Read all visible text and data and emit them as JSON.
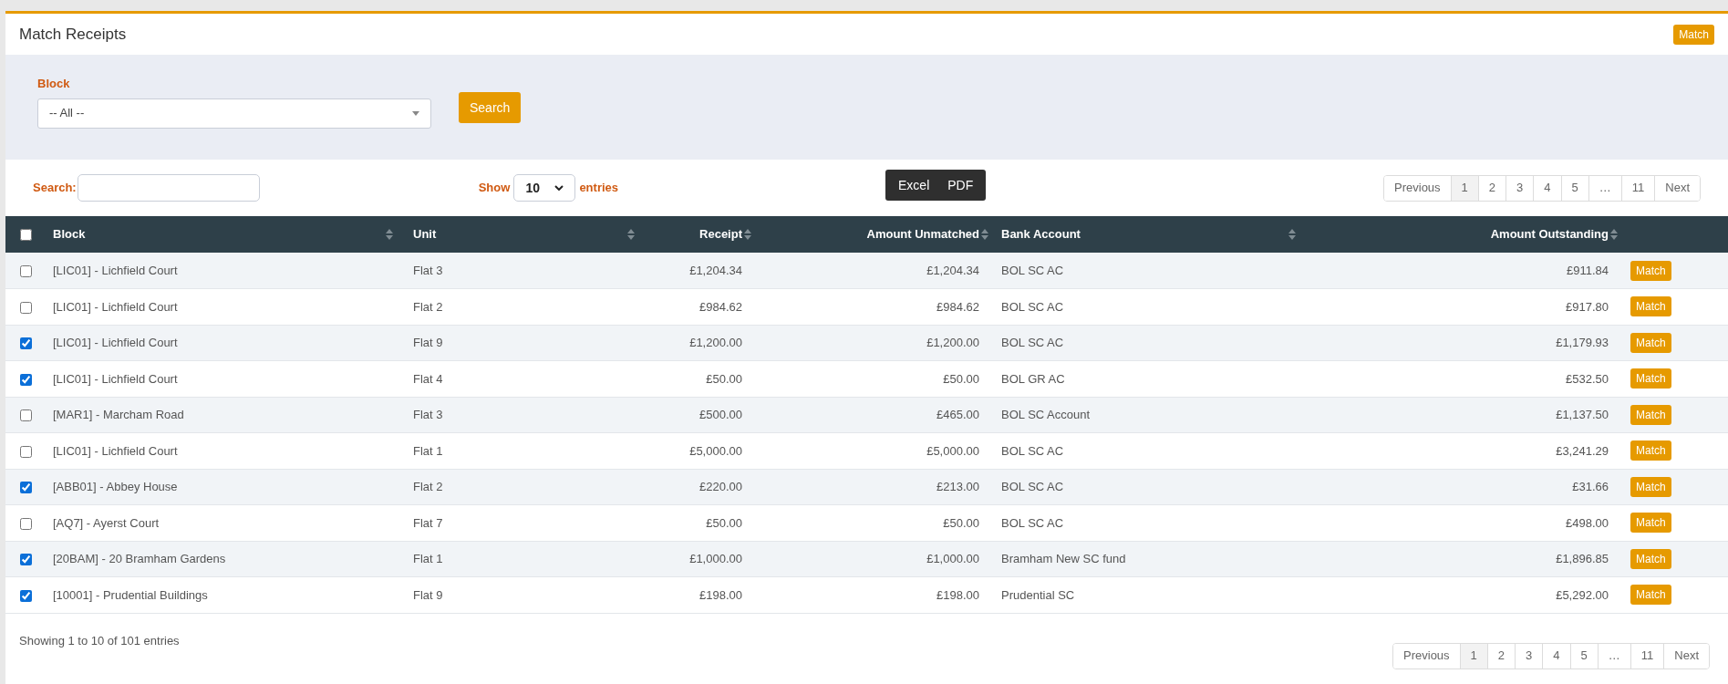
{
  "header": {
    "title": "Match Receipts",
    "action": "Match"
  },
  "filter": {
    "label": "Block",
    "value": "-- All --",
    "button": "Search"
  },
  "toolbar": {
    "search_label": "Search:",
    "show_label": "Show",
    "show_value": "10",
    "entries_label": "entries",
    "exports": [
      "Excel",
      "PDF"
    ]
  },
  "pagination_top": [
    {
      "label": "Previous",
      "selected": false
    },
    {
      "label": "1",
      "selected": true
    },
    {
      "label": "2",
      "selected": false
    },
    {
      "label": "3",
      "selected": false
    },
    {
      "label": "4",
      "selected": false
    },
    {
      "label": "5",
      "selected": false
    },
    {
      "label": "…",
      "selected": false
    },
    {
      "label": "11",
      "selected": false
    },
    {
      "label": "Next",
      "selected": false
    }
  ],
  "table": {
    "select_all_checked": false,
    "columns": [
      {
        "label": "Block",
        "kind": "text"
      },
      {
        "label": "Unit",
        "kind": "text"
      },
      {
        "label": "Receipt",
        "kind": "amount"
      },
      {
        "label": "Amount Unmatched",
        "kind": "amount"
      },
      {
        "label": "Bank Account",
        "kind": "text"
      },
      {
        "label": "Amount Outstanding",
        "kind": "amount"
      }
    ],
    "rows": [
      {
        "checked": false,
        "cells": [
          "[LIC01] - Lichfield Court",
          "Flat 3",
          "£1,204.34",
          "£1,204.34",
          "BOL SC AC",
          "£911.84"
        ],
        "action": "Match"
      },
      {
        "checked": false,
        "cells": [
          "[LIC01] - Lichfield Court",
          "Flat 2",
          "£984.62",
          "£984.62",
          "BOL SC AC",
          "£917.80"
        ],
        "action": "Match"
      },
      {
        "checked": true,
        "cells": [
          "[LIC01] - Lichfield Court",
          "Flat 9",
          "£1,200.00",
          "£1,200.00",
          "BOL SC AC",
          "£1,179.93"
        ],
        "action": "Match"
      },
      {
        "checked": true,
        "cells": [
          "[LIC01] - Lichfield Court",
          "Flat 4",
          "£50.00",
          "£50.00",
          "BOL GR AC",
          "£532.50"
        ],
        "action": "Match"
      },
      {
        "checked": false,
        "cells": [
          "[MAR1] - Marcham Road",
          "Flat 3",
          "£500.00",
          "£465.00",
          "BOL SC Account",
          "£1,137.50"
        ],
        "action": "Match"
      },
      {
        "checked": false,
        "cells": [
          "[LIC01] - Lichfield Court",
          "Flat 1",
          "£5,000.00",
          "£5,000.00",
          "BOL SC AC",
          "£3,241.29"
        ],
        "action": "Match"
      },
      {
        "checked": true,
        "cells": [
          "[ABB01] - Abbey House",
          "Flat 2",
          "£220.00",
          "£213.00",
          "BOL SC AC",
          "£31.66"
        ],
        "action": "Match"
      },
      {
        "checked": false,
        "cells": [
          "[AQ7] - Ayerst Court",
          "Flat 7",
          "£50.00",
          "£50.00",
          "BOL SC AC",
          "£498.00"
        ],
        "action": "Match"
      },
      {
        "checked": true,
        "cells": [
          "[20BAM] - 20 Bramham Gardens",
          "Flat 1",
          "£1,000.00",
          "£1,000.00",
          "Bramham New SC fund",
          "£1,896.85"
        ],
        "action": "Match"
      },
      {
        "checked": true,
        "cells": [
          "[10001] - Prudential Buildings",
          "Flat 9",
          "£198.00",
          "£198.00",
          "Prudential SC",
          "£5,292.00"
        ],
        "action": "Match"
      }
    ]
  },
  "footer": {
    "info": "Showing 1 to 10 of 101 entries"
  },
  "pagination_bottom": [
    {
      "label": "Previous",
      "selected": false
    },
    {
      "label": "1",
      "selected": true
    },
    {
      "label": "2",
      "selected": false
    },
    {
      "label": "3",
      "selected": false
    },
    {
      "label": "4",
      "selected": false
    },
    {
      "label": "5",
      "selected": false
    },
    {
      "label": "…",
      "selected": false
    },
    {
      "label": "11",
      "selected": false
    },
    {
      "label": "Next",
      "selected": false
    }
  ]
}
